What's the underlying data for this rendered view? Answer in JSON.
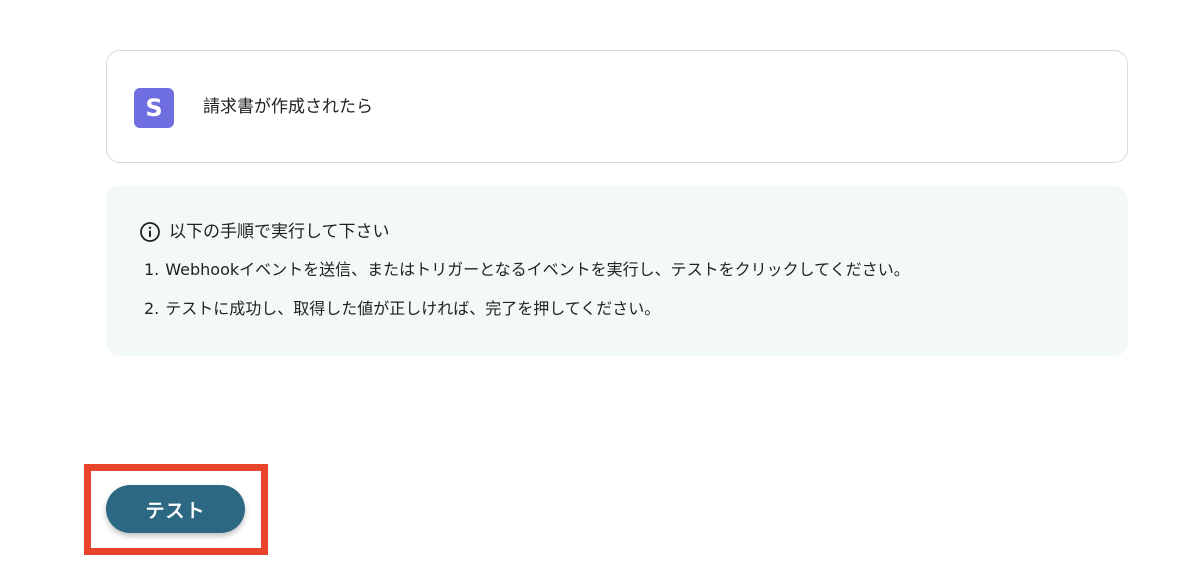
{
  "trigger": {
    "app_icon_letter": "S",
    "app_icon_color": "#6f6ee0",
    "title": "請求書が作成されたら"
  },
  "info": {
    "icon": "info-circle-icon",
    "title": "以下の手順で実行して下さい",
    "steps": [
      {
        "number": "1.",
        "text": "Webhookイベントを送信、またはトリガーとなるイベントを実行し、テストをクリックしてください。"
      },
      {
        "number": "2.",
        "text": "テストに成功し、取得した値が正しければ、完了を押してください。"
      }
    ]
  },
  "actions": {
    "test_label": "テスト",
    "test_button_color": "#2d6883",
    "highlight_color": "#e8432b"
  }
}
